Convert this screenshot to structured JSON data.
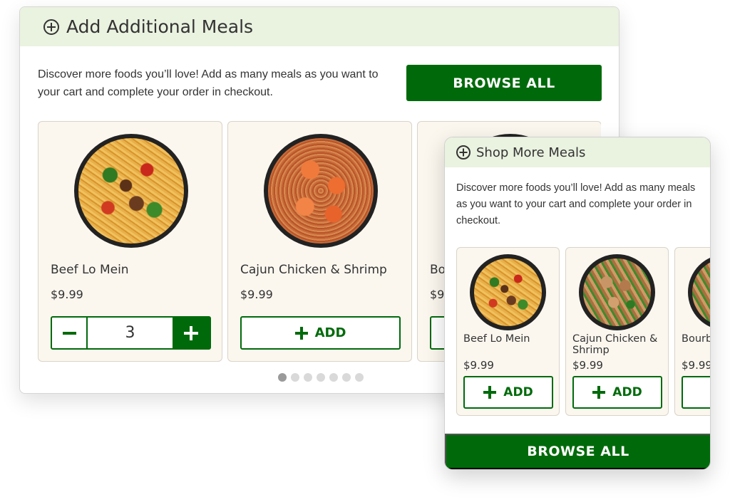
{
  "desktop": {
    "title": "Add Additional Meals",
    "intro": "Discover more foods you’ll love! Add as many meals as you want to your cart and complete your order in checkout.",
    "browse_label": "BROWSE ALL",
    "cards": [
      {
        "name": "Beef Lo Mein",
        "price": "$9.99",
        "quantity": "3"
      },
      {
        "name": "Cajun Chicken & Shrimp",
        "price": "$9.99",
        "add_label": "ADD"
      },
      {
        "name": "Bo",
        "price": "$9"
      }
    ],
    "pagination": {
      "total": 7,
      "active": 1
    }
  },
  "mobile": {
    "title": "Shop More Meals",
    "intro": "Discover more foods you’ll love! Add as many meals as you want to your cart and complete your order in checkout.",
    "browse_label": "BROWSE ALL",
    "cards": [
      {
        "name": "Beef Lo Mein",
        "price": "$9.99",
        "add_label": "ADD"
      },
      {
        "name": "Cajun Chicken & Shrimp",
        "price": "$9.99",
        "add_label": "ADD"
      },
      {
        "name": "Bourb",
        "price": "$9.99"
      }
    ]
  },
  "colors": {
    "brand_green": "#006a0b",
    "header_tint": "#eaf2e0",
    "card_bg": "#fbf7ef"
  }
}
